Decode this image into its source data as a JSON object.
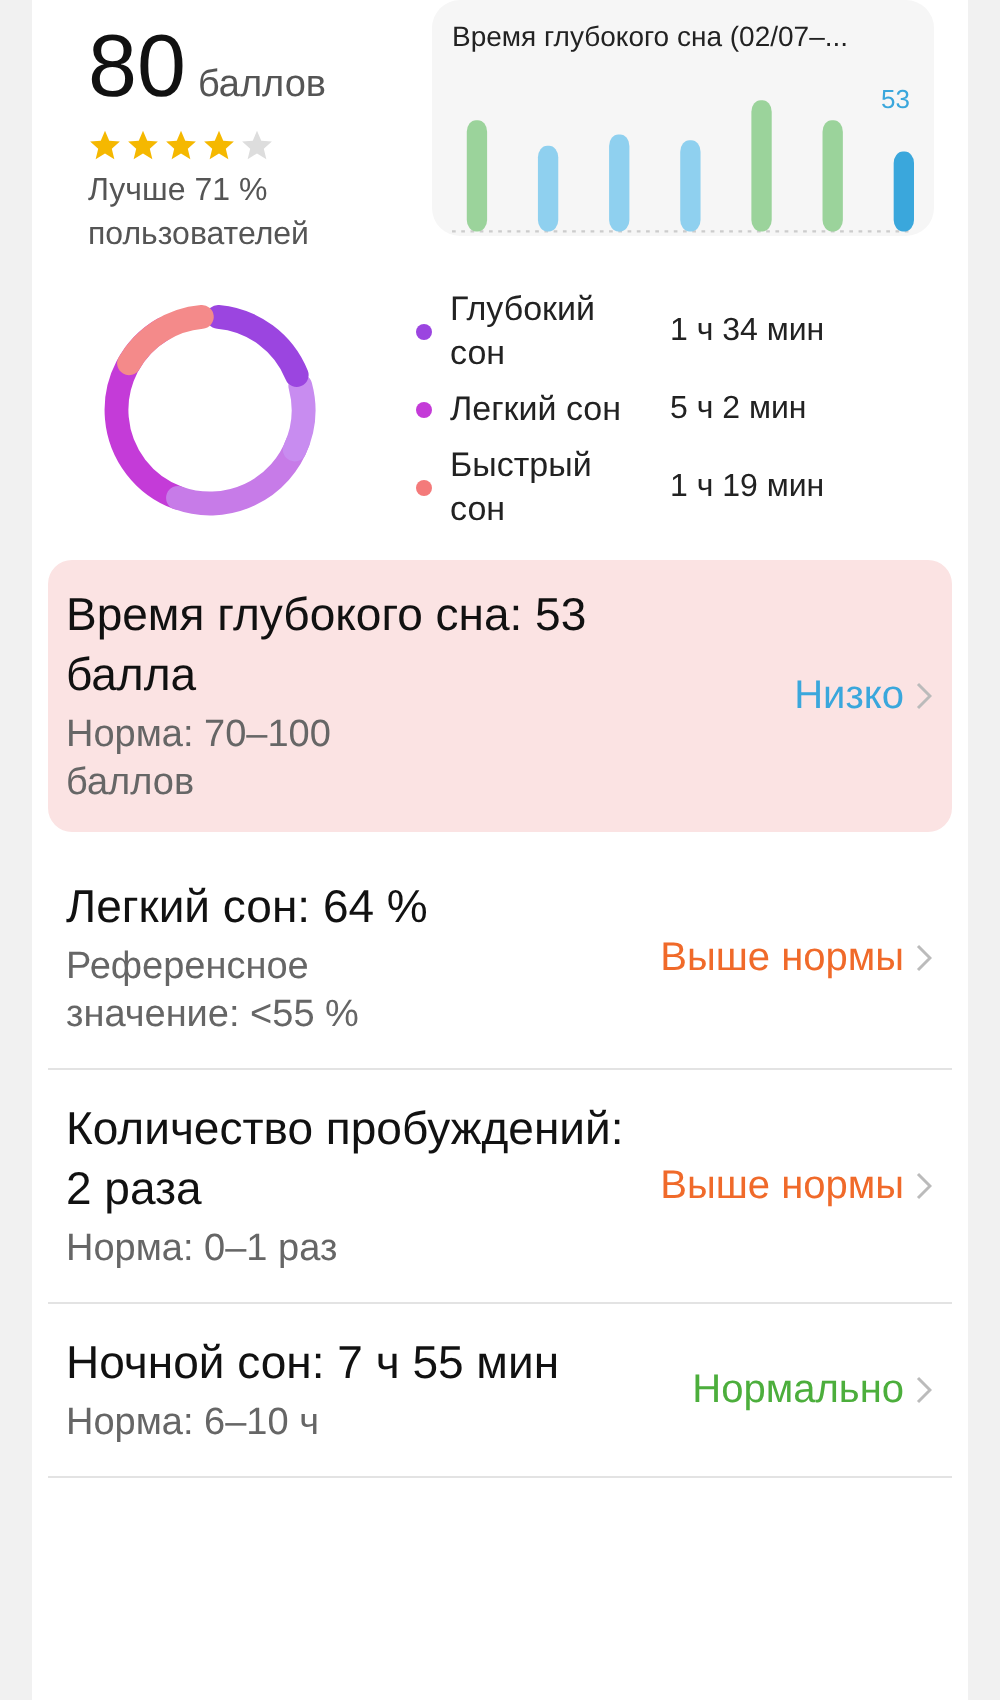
{
  "score": {
    "value": "80",
    "unit": "баллов",
    "stars": 4,
    "comparison": "Лучше 71 % пользователей"
  },
  "deep_sleep_chart": {
    "title": "Время глубокого сна (02/07–...",
    "value_label": "53"
  },
  "legend": [
    {
      "name": "Глубокий сон",
      "duration": "1 ч 34 мин",
      "color": "#9b45e0"
    },
    {
      "name": "Легкий сон",
      "duration": "5 ч 2 мин",
      "color": "#c43bd8"
    },
    {
      "name": "Быстрый сон",
      "duration": "1 ч 19 мин",
      "color": "#f47a7a"
    }
  ],
  "metrics": [
    {
      "title": "Время глубокого сна: 53 балла",
      "note": "Норма: 70–100 баллов",
      "status": "Низко",
      "kind": "low",
      "highlighted": true
    },
    {
      "title": "Легкий сон: 64 %",
      "note": "Референсное значение: <55 %",
      "status": "Выше нормы",
      "kind": "high",
      "highlighted": false
    },
    {
      "title": "Количество пробуждений: 2 раза",
      "note": "Норма: 0–1 раз",
      "status": "Выше нормы",
      "kind": "high",
      "highlighted": false
    },
    {
      "title": "Ночной сон: 7 ч 55 мин",
      "note": "Норма: 6–10 ч",
      "status": "Нормально",
      "kind": "normal",
      "highlighted": false
    }
  ]
}
